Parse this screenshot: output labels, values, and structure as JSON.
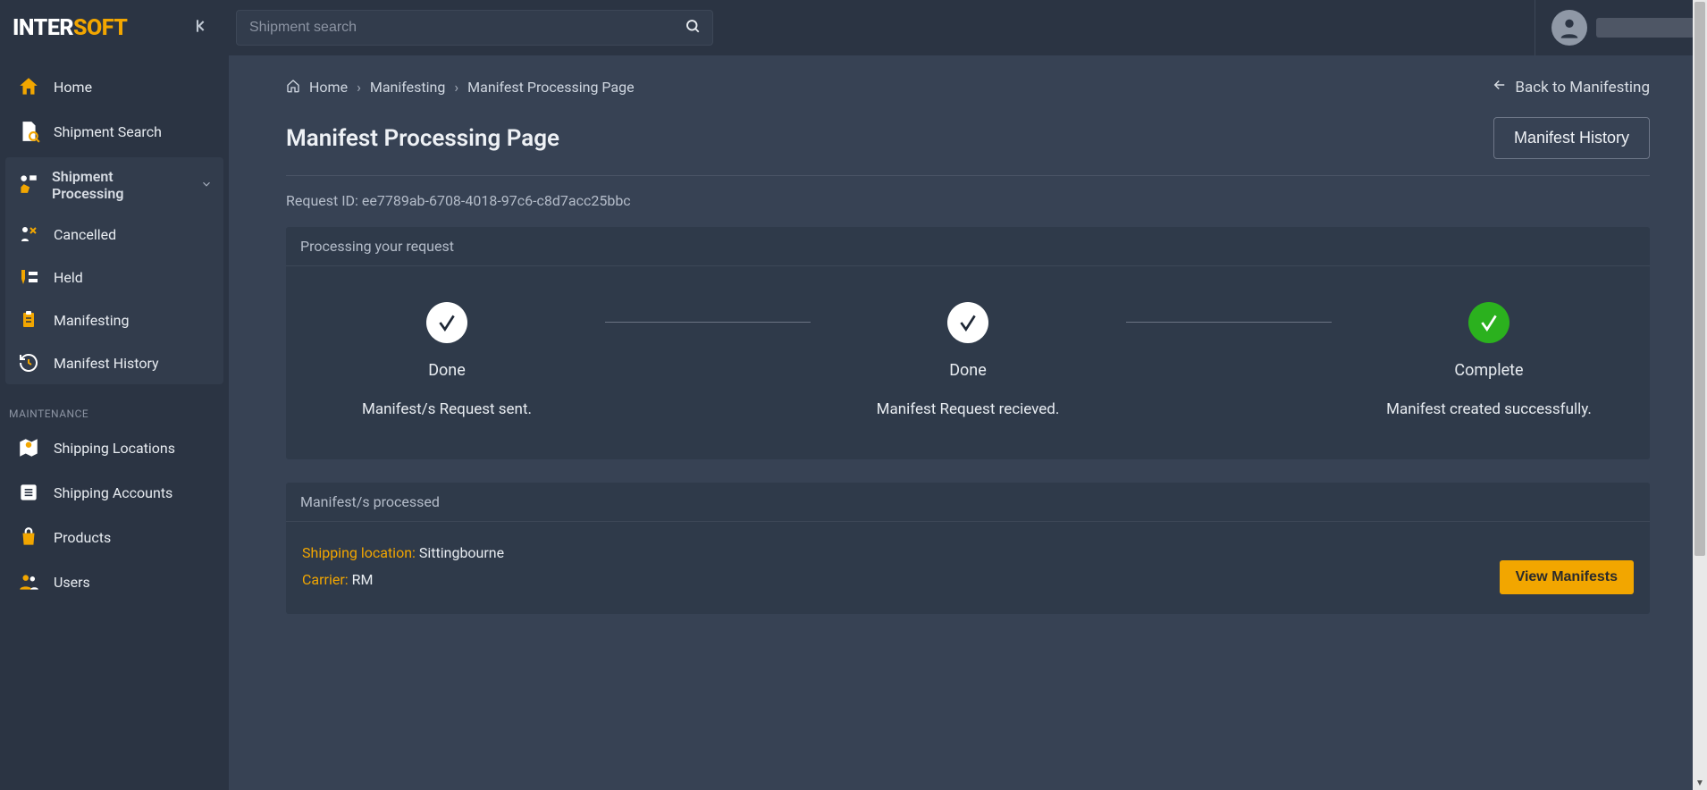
{
  "logo": {
    "left": "INTER",
    "right": "SOFT"
  },
  "search": {
    "placeholder": "Shipment search"
  },
  "sidebar": {
    "items": [
      {
        "label": "Home"
      },
      {
        "label": "Shipment Search"
      }
    ],
    "group": {
      "header": "Shipment Processing",
      "items": [
        {
          "label": "Cancelled"
        },
        {
          "label": "Held"
        },
        {
          "label": "Manifesting"
        },
        {
          "label": "Manifest History"
        }
      ]
    },
    "section": "MAINTENANCE",
    "maint": [
      {
        "label": "Shipping Locations"
      },
      {
        "label": "Shipping Accounts"
      },
      {
        "label": "Products"
      },
      {
        "label": "Users"
      }
    ]
  },
  "breadcrumb": {
    "home": "Home",
    "mid": "Manifesting",
    "current": "Manifest Processing Page"
  },
  "back_link": "Back to Manifesting",
  "page_title": "Manifest Processing Page",
  "history_button": "Manifest History",
  "request_id_label": "Request ID:",
  "request_id_value": "ee7789ab-6708-4018-97c6-c8d7acc25bbc",
  "processing_panel": {
    "header": "Processing your request",
    "steps": [
      {
        "status": "Done",
        "desc": "Manifest/s Request sent.",
        "green": false
      },
      {
        "status": "Done",
        "desc": "Manifest Request recieved.",
        "green": false
      },
      {
        "status": "Complete",
        "desc": "Manifest created successfully.",
        "green": true
      }
    ]
  },
  "result_panel": {
    "header": "Manifest/s processed",
    "ship_loc_label": "Shipping location:",
    "ship_loc_value": "Sittingbourne",
    "carrier_label": "Carrier:",
    "carrier_value": "RM",
    "button": "View Manifests"
  }
}
